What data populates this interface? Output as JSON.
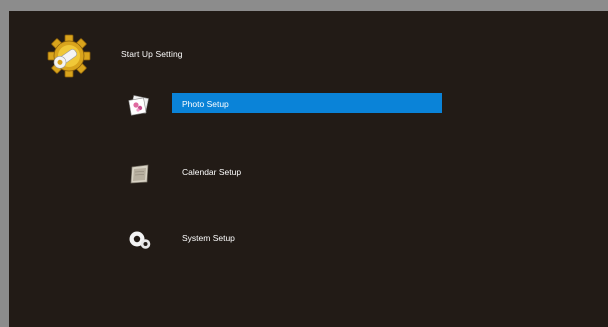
{
  "header": {
    "title": "Start Up Setting",
    "icon": "gear-icon"
  },
  "menu": {
    "selected_index": 0,
    "items": [
      {
        "label": "Photo Setup",
        "icon": "photo-icon"
      },
      {
        "label": "Calendar Setup",
        "icon": "calendar-icon"
      },
      {
        "label": "System Setup",
        "icon": "system-gears-icon"
      }
    ]
  },
  "colors": {
    "background": "#221b16",
    "bezel": "#8c8c8c",
    "selection": "#0a83d8",
    "text": "#ffffff",
    "gear_gold": "#e0b020"
  }
}
